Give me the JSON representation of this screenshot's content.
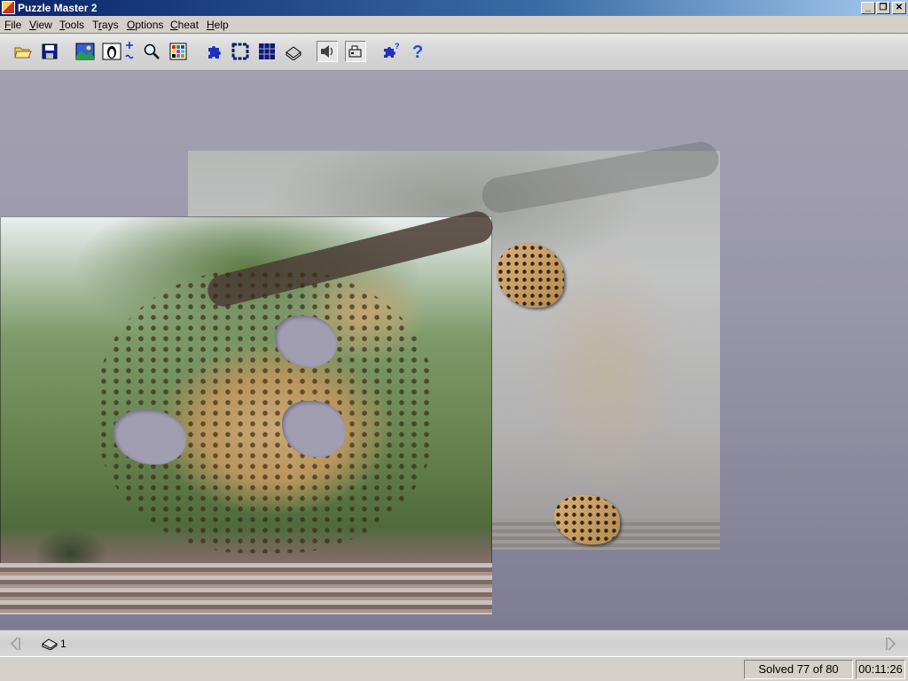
{
  "window": {
    "title": "Puzzle Master 2",
    "controls": [
      "minimize",
      "restore",
      "close"
    ]
  },
  "menu": {
    "items": [
      {
        "label": "File",
        "underline": "F"
      },
      {
        "label": "View",
        "underline": "V"
      },
      {
        "label": "Tools",
        "underline": "T"
      },
      {
        "label": "Trays",
        "underline": "r"
      },
      {
        "label": "Options",
        "underline": "O"
      },
      {
        "label": "Cheat",
        "underline": "C"
      },
      {
        "label": "Help",
        "underline": "H"
      }
    ]
  },
  "toolbar": {
    "buttons": [
      {
        "name": "open-folder-icon"
      },
      {
        "name": "save-disk-icon"
      },
      {
        "name": "picture-icon"
      },
      {
        "name": "penguin-picture-icon"
      },
      {
        "name": "size-adjust-icon"
      },
      {
        "name": "magnifier-icon"
      },
      {
        "name": "color-grid-icon"
      },
      {
        "name": "puzzle-piece-icon"
      },
      {
        "name": "edge-pieces-icon"
      },
      {
        "name": "grid-pieces-icon"
      },
      {
        "name": "tray-print-icon"
      },
      {
        "name": "sound-toggle-icon",
        "pressed": true
      },
      {
        "name": "music-toggle-icon",
        "pressed": true
      },
      {
        "name": "puzzle-help-icon"
      },
      {
        "name": "help-question-icon"
      }
    ]
  },
  "tray": {
    "count": "1"
  },
  "status": {
    "solved": "Solved 77 of 80",
    "time": "00:11:26"
  },
  "colors": {
    "titlebar_start": "#0a246a",
    "workspace": "#9997aa",
    "status_bg": "#d4d0c8"
  }
}
